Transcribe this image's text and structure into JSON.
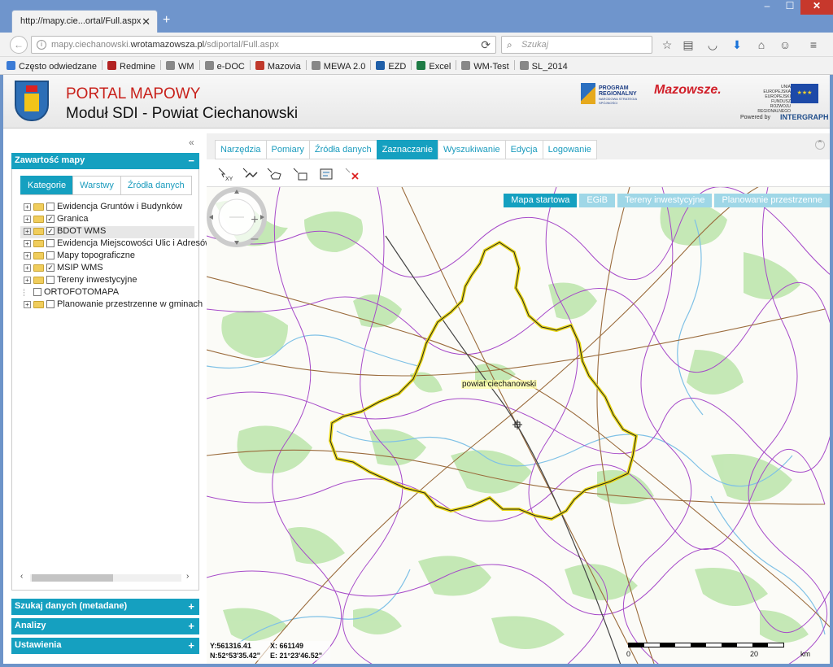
{
  "browser": {
    "tab_title": "http://mapy.cie...ortal/Full.aspx",
    "url_gray_prefix": "mapy.ciechanowski.",
    "url_domain": "wrotamazowsza.pl",
    "url_path": "/sdiportal/Full.aspx",
    "search_placeholder": "Szukaj",
    "bookmarks": [
      {
        "label": "Często odwiedzane",
        "color": "#3b7bd6"
      },
      {
        "label": "Redmine",
        "color": "#b22222"
      },
      {
        "label": "WM",
        "color": "#888888"
      },
      {
        "label": "e-DOC",
        "color": "#888888"
      },
      {
        "label": "Mazovia",
        "color": "#c0392b"
      },
      {
        "label": "MEWA 2.0",
        "color": "#888888"
      },
      {
        "label": "EZD",
        "color": "#1f5fa8"
      },
      {
        "label": "Excel",
        "color": "#1e7b45"
      },
      {
        "label": "WM-Test",
        "color": "#888888"
      },
      {
        "label": "SL_2014",
        "color": "#888888"
      }
    ]
  },
  "header": {
    "title": "PORTAL MAPOWY",
    "subtitle": "Moduł SDI - Powiat Ciechanowski",
    "logo_program": "PROGRAM REGIONALNY",
    "logo_program_sub": "NARODOWA STRATEGIA SPÓJNOŚCI",
    "logo_mazowsze": "Mazowsze.",
    "logo_ue": "UNIA EUROPEJSKA EUROPEJSKI FUNDUSZ ROZWOJU REGIONALNEGO",
    "powered_by": "Powered by",
    "intergraph": "INTERGRAPH"
  },
  "left_panel": {
    "title": "Zawartość mapy",
    "toggle": "−",
    "tabs": [
      "Kategorie",
      "Warstwy",
      "Źródła danych"
    ],
    "tree": [
      {
        "label": "Ewidencja Gruntów i Budynków",
        "checked": false,
        "expandable": true
      },
      {
        "label": "Granica",
        "checked": true,
        "expandable": true
      },
      {
        "label": "BDOT WMS",
        "checked": true,
        "expandable": true
      },
      {
        "label": "Ewidencja Miejscowości Ulic i Adresów",
        "checked": false,
        "expandable": true
      },
      {
        "label": "Mapy topograficzne",
        "checked": false,
        "expandable": true
      },
      {
        "label": "MSIP WMS",
        "checked": true,
        "expandable": true
      },
      {
        "label": "Tereny inwestycyjne",
        "checked": false,
        "expandable": true
      },
      {
        "label": "ORTOFOTOMAPA",
        "checked": false,
        "expandable": false
      },
      {
        "label": "Planowanie przestrzenne w gminach",
        "checked": false,
        "expandable": true
      }
    ],
    "accordion": [
      {
        "label": "Szukaj danych (metadane)",
        "toggle": "+"
      },
      {
        "label": "Analizy",
        "toggle": "+"
      },
      {
        "label": "Ustawienia",
        "toggle": "+"
      }
    ]
  },
  "main_tabs": [
    "Narzędzia",
    "Pomiary",
    "Źródła danych",
    "Zaznaczanie",
    "Wyszukiwanie",
    "Edycja",
    "Logowanie"
  ],
  "active_main_tab": "Zaznaczanie",
  "toolbar_icons": [
    "select-xy-icon",
    "select-line-icon",
    "select-polygon-icon",
    "select-rectangle-icon",
    "select-layer-icon",
    "clear-selection-icon"
  ],
  "map": {
    "buttons": [
      "Mapa startowa",
      "EGiB",
      "Tereny inwestycyjne",
      "Planowanie przestrzenne"
    ],
    "region_label": "powiat ciechanowski",
    "coord_y": "Y:561316.41",
    "coord_x": "X: 661149",
    "coord_n": "N:52°53'35.42\"",
    "coord_e": "E: 21°23'46.52\"",
    "scale_ticks": [
      "0",
      "20",
      "km"
    ],
    "colors": {
      "boundary": "#e8d400",
      "admin": "#a64ac9",
      "roads": "#9a6b3c",
      "water": "#7fc1e6",
      "forest": "#b9e3a5"
    }
  }
}
